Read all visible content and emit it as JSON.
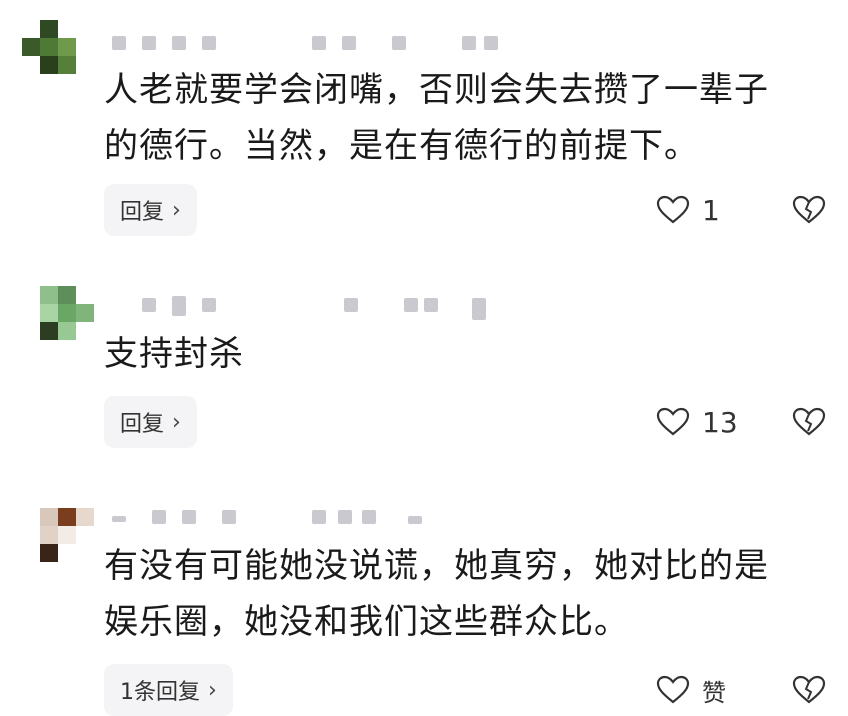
{
  "comments": [
    {
      "text": "人老就要学会闭嘴，否则会失去攒了一辈子\n的德行。当然，是在有德行的前提下。",
      "reply_label": "回复",
      "like_count": "1"
    },
    {
      "text": "支持封杀",
      "reply_label": "回复",
      "like_count": "13"
    },
    {
      "text": "有没有可能她没说谎，她真穷，她对比的是\n娱乐圈，她没和我们这些群众比。",
      "reply_label": "1条回复",
      "like_count": "赞"
    }
  ],
  "icons": {
    "like": "heart-outline-icon",
    "dislike": "broken-heart-outline-icon",
    "reply_arrow": "chevron-right-icon"
  },
  "colors": {
    "reply_bg": "#f4f4f6",
    "text": "#1a1a1a"
  }
}
